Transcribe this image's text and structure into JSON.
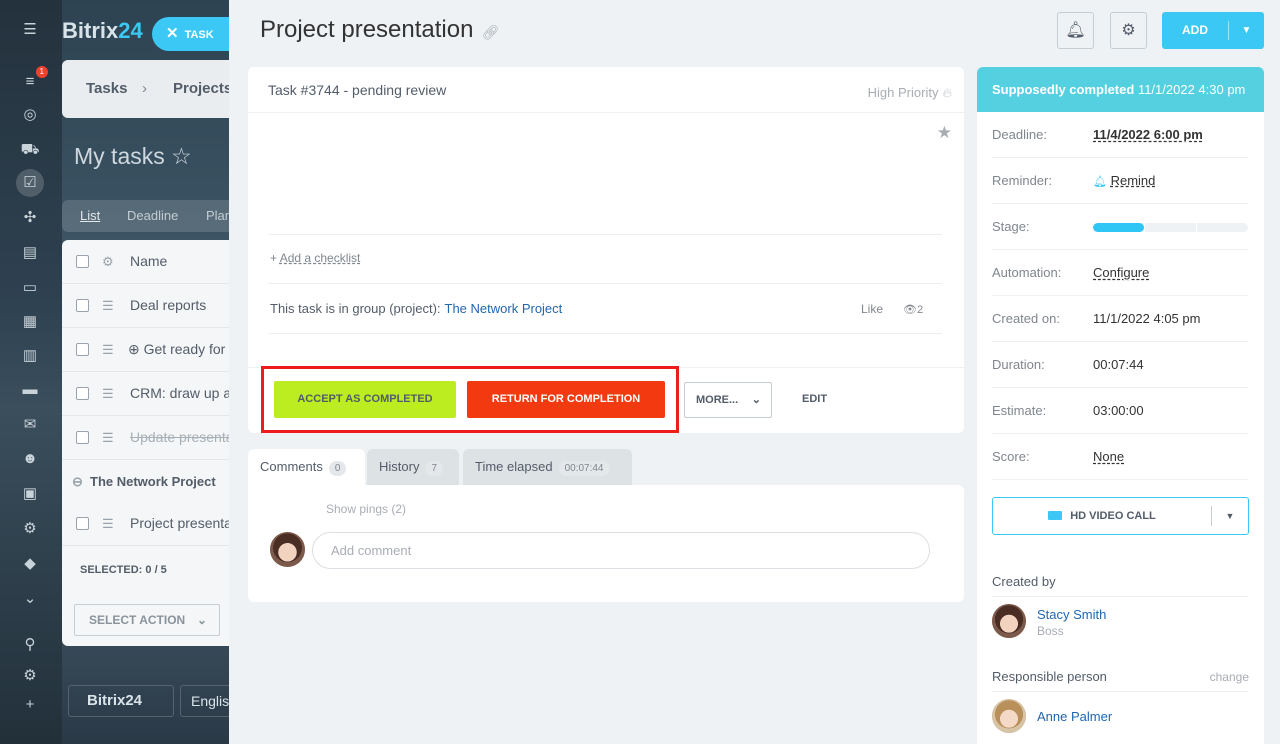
{
  "background": {
    "logo_text": "Bitrix",
    "logo_num": "24",
    "task_pill": "TASK",
    "notification_count": "1",
    "crumbs": [
      "Tasks",
      "Projects"
    ],
    "page_title": "My tasks",
    "view_tabs": [
      "List",
      "Deadline",
      "Plan"
    ],
    "grid_header": "Name",
    "rows": [
      "Deal reports",
      "Get ready for",
      "CRM: draw up a",
      "Update presentat",
      "Project presenta"
    ],
    "group_name": "The Network Project",
    "selected_label": "SELECTED: 0 / 5",
    "select_action": "SELECT ACTION",
    "footer_logo": "Bitrix24",
    "footer_lang": "Englis"
  },
  "slider": {
    "title": "Project presentation",
    "add_label": "ADD",
    "task": {
      "name": "Task #3744 - pending review",
      "priority": "High Priority",
      "add_checklist": "Add a checklist",
      "group_prefix": "This task is in group (project):",
      "group_link": "The Network Project",
      "like": "Like",
      "views": "2"
    },
    "actions": {
      "accept": "ACCEPT AS COMPLETED",
      "return": "RETURN FOR COMPLETION",
      "more": "MORE...",
      "edit": "EDIT"
    },
    "tabs": [
      {
        "label": "Comments",
        "count": "0"
      },
      {
        "label": "History",
        "count": "7"
      },
      {
        "label": "Time elapsed",
        "count": "00:07:44"
      }
    ],
    "comments": {
      "show_pings": "Show pings (2)",
      "placeholder": "Add comment"
    },
    "sidebar": {
      "header_bold": "Supposedly completed",
      "header_date": "11/1/2022 4:30 pm",
      "rows": [
        {
          "label": "Deadline:",
          "value": "11/4/2022 6:00 pm"
        },
        {
          "label": "Reminder:",
          "value": "Remind"
        },
        {
          "label": "Stage:",
          "value": ""
        },
        {
          "label": "Automation:",
          "value": "Configure"
        },
        {
          "label": "Created on:",
          "value": "11/1/2022 4:05 pm"
        },
        {
          "label": "Duration:",
          "value": "00:07:44"
        },
        {
          "label": "Estimate:",
          "value": "03:00:00"
        },
        {
          "label": "Score:",
          "value": "None"
        }
      ],
      "stage_progress": 0.33,
      "video_call": "HD VIDEO CALL",
      "created_by_label": "Created by",
      "creator_name": "Stacy Smith",
      "creator_role": "Boss",
      "responsible_label": "Responsible person",
      "change": "change",
      "responsible_name": "Anne Palmer"
    },
    "colors": {
      "accent": "#3bc8f5",
      "accept": "#bbed21",
      "return": "#f2390f",
      "highlight": "#ee1c1c",
      "sidebar_header": "#55d0e0"
    }
  }
}
